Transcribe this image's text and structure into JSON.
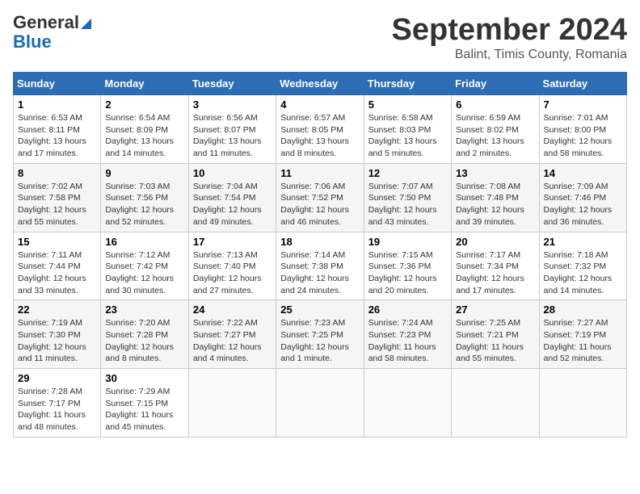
{
  "header": {
    "logo_line1": "General",
    "logo_line2": "Blue",
    "month": "September 2024",
    "location": "Balint, Timis County, Romania"
  },
  "weekdays": [
    "Sunday",
    "Monday",
    "Tuesday",
    "Wednesday",
    "Thursday",
    "Friday",
    "Saturday"
  ],
  "weeks": [
    [
      {
        "day": "1",
        "sunrise": "6:53 AM",
        "sunset": "8:11 PM",
        "daylight": "13 hours and 17 minutes."
      },
      {
        "day": "2",
        "sunrise": "6:54 AM",
        "sunset": "8:09 PM",
        "daylight": "13 hours and 14 minutes."
      },
      {
        "day": "3",
        "sunrise": "6:56 AM",
        "sunset": "8:07 PM",
        "daylight": "13 hours and 11 minutes."
      },
      {
        "day": "4",
        "sunrise": "6:57 AM",
        "sunset": "8:05 PM",
        "daylight": "13 hours and 8 minutes."
      },
      {
        "day": "5",
        "sunrise": "6:58 AM",
        "sunset": "8:03 PM",
        "daylight": "13 hours and 5 minutes."
      },
      {
        "day": "6",
        "sunrise": "6:59 AM",
        "sunset": "8:02 PM",
        "daylight": "13 hours and 2 minutes."
      },
      {
        "day": "7",
        "sunrise": "7:01 AM",
        "sunset": "8:00 PM",
        "daylight": "12 hours and 58 minutes."
      }
    ],
    [
      {
        "day": "8",
        "sunrise": "7:02 AM",
        "sunset": "7:58 PM",
        "daylight": "12 hours and 55 minutes."
      },
      {
        "day": "9",
        "sunrise": "7:03 AM",
        "sunset": "7:56 PM",
        "daylight": "12 hours and 52 minutes."
      },
      {
        "day": "10",
        "sunrise": "7:04 AM",
        "sunset": "7:54 PM",
        "daylight": "12 hours and 49 minutes."
      },
      {
        "day": "11",
        "sunrise": "7:06 AM",
        "sunset": "7:52 PM",
        "daylight": "12 hours and 46 minutes."
      },
      {
        "day": "12",
        "sunrise": "7:07 AM",
        "sunset": "7:50 PM",
        "daylight": "12 hours and 43 minutes."
      },
      {
        "day": "13",
        "sunrise": "7:08 AM",
        "sunset": "7:48 PM",
        "daylight": "12 hours and 39 minutes."
      },
      {
        "day": "14",
        "sunrise": "7:09 AM",
        "sunset": "7:46 PM",
        "daylight": "12 hours and 36 minutes."
      }
    ],
    [
      {
        "day": "15",
        "sunrise": "7:11 AM",
        "sunset": "7:44 PM",
        "daylight": "12 hours and 33 minutes."
      },
      {
        "day": "16",
        "sunrise": "7:12 AM",
        "sunset": "7:42 PM",
        "daylight": "12 hours and 30 minutes."
      },
      {
        "day": "17",
        "sunrise": "7:13 AM",
        "sunset": "7:40 PM",
        "daylight": "12 hours and 27 minutes."
      },
      {
        "day": "18",
        "sunrise": "7:14 AM",
        "sunset": "7:38 PM",
        "daylight": "12 hours and 24 minutes."
      },
      {
        "day": "19",
        "sunrise": "7:15 AM",
        "sunset": "7:36 PM",
        "daylight": "12 hours and 20 minutes."
      },
      {
        "day": "20",
        "sunrise": "7:17 AM",
        "sunset": "7:34 PM",
        "daylight": "12 hours and 17 minutes."
      },
      {
        "day": "21",
        "sunrise": "7:18 AM",
        "sunset": "7:32 PM",
        "daylight": "12 hours and 14 minutes."
      }
    ],
    [
      {
        "day": "22",
        "sunrise": "7:19 AM",
        "sunset": "7:30 PM",
        "daylight": "12 hours and 11 minutes."
      },
      {
        "day": "23",
        "sunrise": "7:20 AM",
        "sunset": "7:28 PM",
        "daylight": "12 hours and 8 minutes."
      },
      {
        "day": "24",
        "sunrise": "7:22 AM",
        "sunset": "7:27 PM",
        "daylight": "12 hours and 4 minutes."
      },
      {
        "day": "25",
        "sunrise": "7:23 AM",
        "sunset": "7:25 PM",
        "daylight": "12 hours and 1 minute."
      },
      {
        "day": "26",
        "sunrise": "7:24 AM",
        "sunset": "7:23 PM",
        "daylight": "11 hours and 58 minutes."
      },
      {
        "day": "27",
        "sunrise": "7:25 AM",
        "sunset": "7:21 PM",
        "daylight": "11 hours and 55 minutes."
      },
      {
        "day": "28",
        "sunrise": "7:27 AM",
        "sunset": "7:19 PM",
        "daylight": "11 hours and 52 minutes."
      }
    ],
    [
      {
        "day": "29",
        "sunrise": "7:28 AM",
        "sunset": "7:17 PM",
        "daylight": "11 hours and 48 minutes."
      },
      {
        "day": "30",
        "sunrise": "7:29 AM",
        "sunset": "7:15 PM",
        "daylight": "11 hours and 45 minutes."
      },
      null,
      null,
      null,
      null,
      null
    ]
  ]
}
